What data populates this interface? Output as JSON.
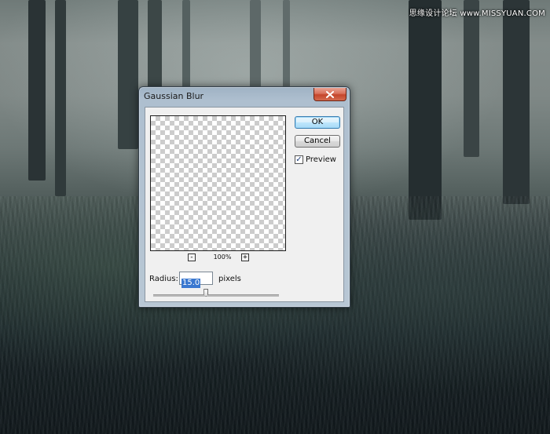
{
  "watermark": {
    "text": "思缘设计论坛 www.MISSYUAN.COM"
  },
  "dialog": {
    "title": "Gaussian Blur",
    "ok_label": "OK",
    "cancel_label": "Cancel",
    "preview_label": "Preview",
    "preview_checked": true,
    "preview_check_glyph": "✓",
    "zoom_out_label": "-",
    "zoom_in_label": "+",
    "zoom_level": "100%",
    "radius_label": "Radius:",
    "radius_value": "15.0",
    "radius_unit": "pixels",
    "radius_slider_position": 0.42,
    "close_icon": "close-icon",
    "colors": {
      "close_button": "#c4452b",
      "ok_button_border": "#3c7fb1",
      "selection": "#3a78d0"
    }
  }
}
